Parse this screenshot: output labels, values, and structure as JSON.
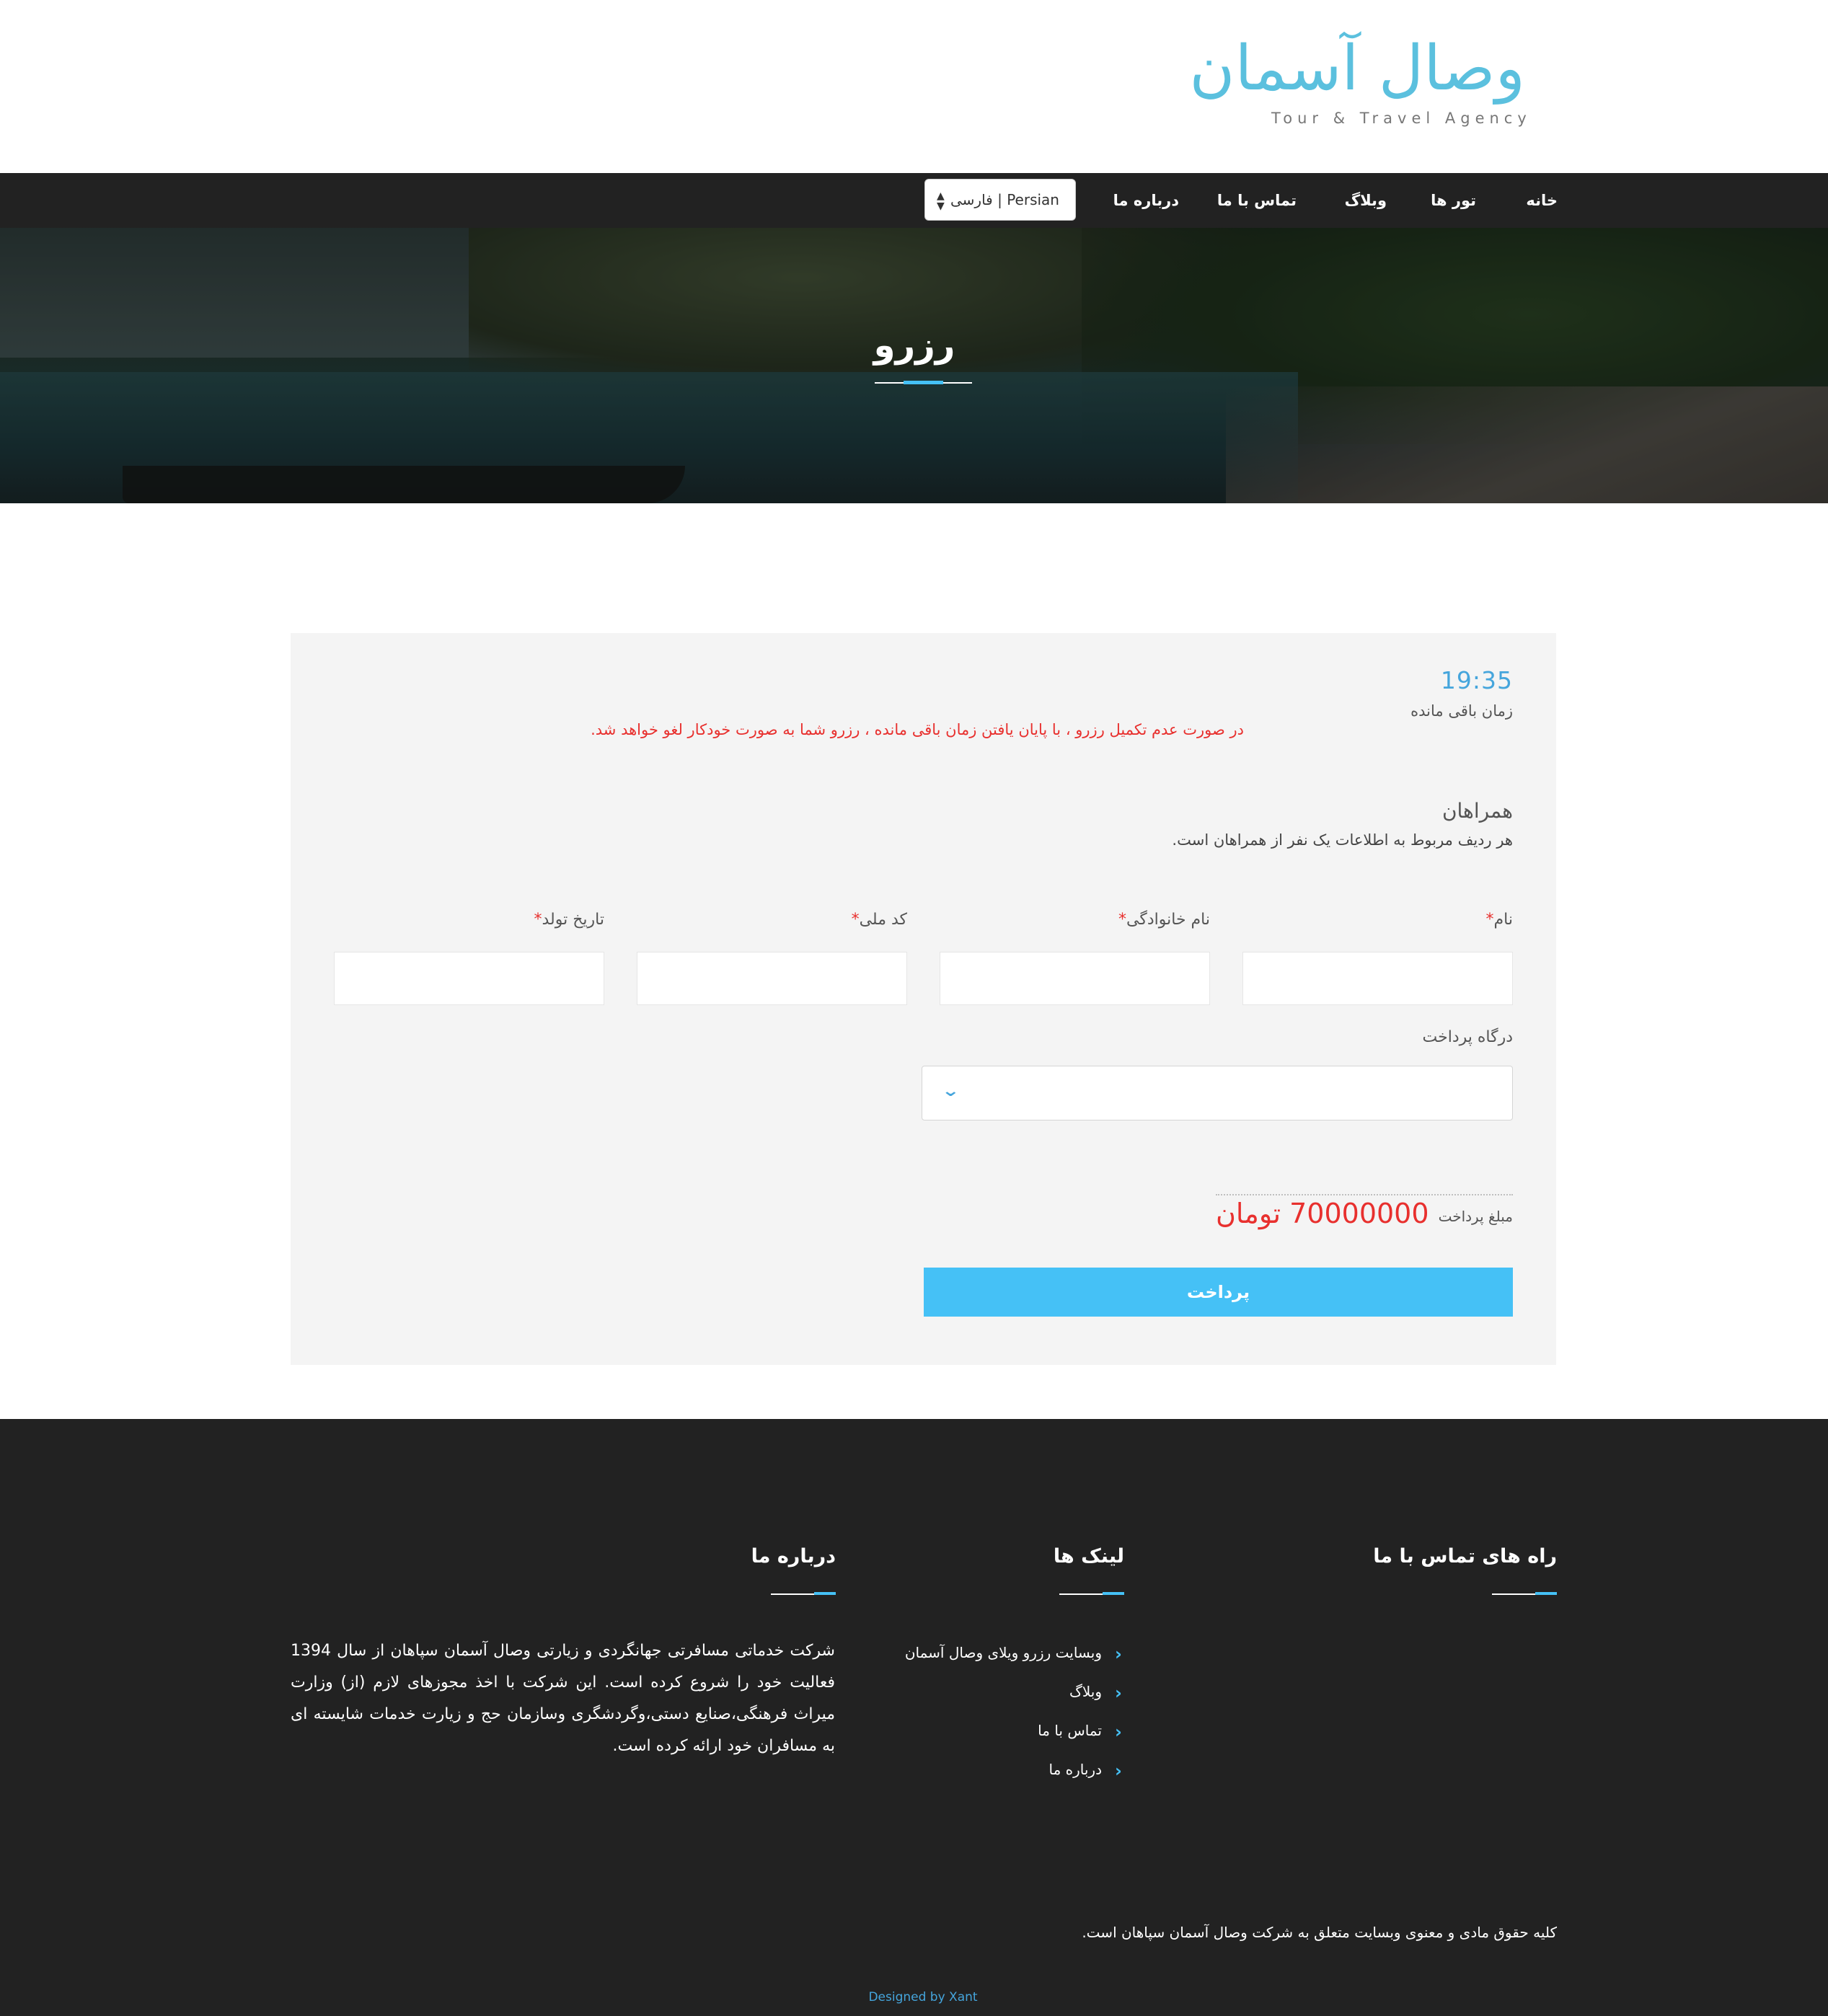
{
  "header": {
    "logo_text": "وصال آسمان",
    "logo_tagline": "Tour & Travel Agency"
  },
  "nav": {
    "items": [
      {
        "label": "خانه"
      },
      {
        "label": "تور ها"
      },
      {
        "label": "وبلاگ"
      },
      {
        "label": "تماس با ما"
      },
      {
        "label": "درباره ما"
      }
    ],
    "language": {
      "selected": "Persian | فارسی"
    }
  },
  "hero": {
    "title": "رزرو"
  },
  "booking": {
    "timer": "19:35",
    "timer_label": "زمان باقی مانده",
    "warning": "در صورت عدم تکمیل رزرو ، با پایان یافتن زمان باقی مانده ، رزرو شما به صورت خودکار لغو خواهد شد.",
    "companions_title": "همراهان",
    "companions_desc": "هر ردیف مربوط به اطلاعات یک نفر از همراهان است.",
    "fields": [
      {
        "label": "نام",
        "value": ""
      },
      {
        "label": "نام خانوادگی",
        "value": ""
      },
      {
        "label": "کد ملی",
        "value": ""
      },
      {
        "label": "تاریخ تولد",
        "value": ""
      }
    ],
    "required_mark": "*",
    "gateway_label": "درگاه پرداخت",
    "gateway_selected": "",
    "amount_label": "مبلغ پرداخت",
    "amount_value": "70000000 تومان",
    "pay_label": "پرداخت"
  },
  "footer": {
    "contact_title": "راه های تماس با ما",
    "links_title": "لینک ها",
    "links": [
      {
        "label": "وبسایت رزرو ویلای وصال آسمان"
      },
      {
        "label": "وبلاگ"
      },
      {
        "label": "تماس با ما"
      },
      {
        "label": "درباره ما"
      }
    ],
    "about_title": "درباره ما",
    "about_text": "شرکت خدماتی مسافرتی جهانگردی و زیارتی وصال آسمان سپاهان از سال 1394 فعالیت خود را شروع کرده است. این شرکت با اخذ مجوزهای لازم (از) وزارت میراث فرهنگی،صنایع دستی،وگردشگری وسازمان حج و زیارت خدمات شایسته ای به مسافران خود ارائه کرده است.",
    "copyright": "کلیه حقوق مادی و معنوی وبسایت متعلق به شرکت وصال آسمان سپاهان است.",
    "designed_by": "Designed by Xant"
  },
  "colors": {
    "accent": "#45c1f6",
    "danger": "#e8302e",
    "dark": "#222222",
    "panel": "#f4f4f4"
  },
  "icons": {
    "gateway_dropdown": "chevron-down-icon",
    "language_dropdown": "sort-arrows-icon",
    "footer_link": "chevron-left-icon"
  }
}
